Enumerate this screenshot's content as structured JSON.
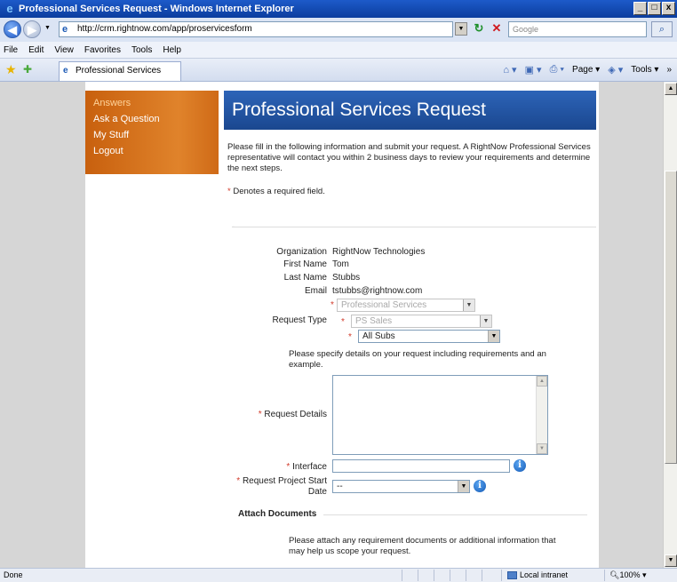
{
  "window": {
    "title": "Professional Services Request - Windows Internet Explorer",
    "min": "_",
    "max": "□",
    "close": "x"
  },
  "address": {
    "url": "http://crm.rightnow.com/app/proservicesform",
    "search_placeholder": "Google"
  },
  "menu": {
    "file": "File",
    "edit": "Edit",
    "view": "View",
    "favorites": "Favorites",
    "tools": "Tools",
    "help": "Help"
  },
  "tab": {
    "label": "Professional Services Request"
  },
  "toolbar": {
    "page": "Page",
    "tools": "Tools"
  },
  "nav": {
    "items": [
      "Answers",
      "Ask a Question",
      "My Stuff",
      "Logout"
    ]
  },
  "page": {
    "heading": "Professional Services Request",
    "intro": "Please fill in the following information and submit your request. A RightNow Professional Services representative will contact you within 2 business days to review your requirements and determine the next steps.",
    "required_note": "Denotes a required field.",
    "required_marker": "*"
  },
  "form": {
    "organization_label": "Organization",
    "organization_value": "RightNow Technologies",
    "first_name_label": "First Name",
    "first_name_value": "Tom",
    "last_name_label": "Last Name",
    "last_name_value": "Stubbs",
    "email_label": "Email",
    "email_value": "tstubbs@rightnow.com",
    "request_type_label": "Request Type",
    "request_type_1": "Professional Services",
    "request_type_2": "PS Sales",
    "request_type_3": "All Subs",
    "details_prompt": "Please specify details on your request including requirements and an example.",
    "request_details_label": "Request Details",
    "interface_label": "Interface",
    "start_date_label_1": "Request Project Start",
    "start_date_label_2": "Date",
    "start_date_value": "--"
  },
  "attach": {
    "heading": "Attach Documents",
    "text": "Please attach any requirement documents or additional information that may help us scope your request."
  },
  "status": {
    "left": "Done",
    "zone": "Local intranet",
    "zoom": "100%"
  }
}
